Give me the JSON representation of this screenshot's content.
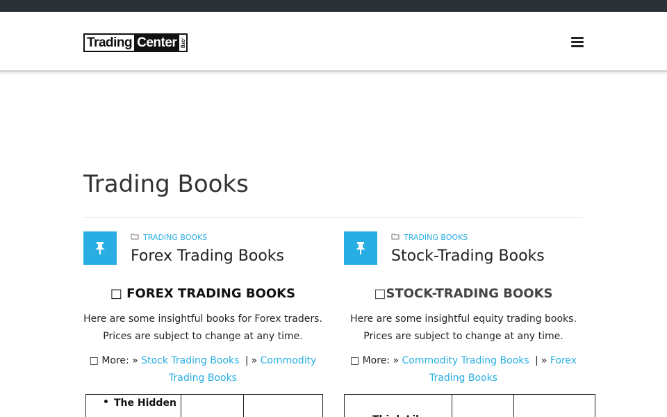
{
  "header": {
    "logo_part1": "Trading",
    "logo_part2": "Center",
    "logo_part3": ".org",
    "menu_icon": "hamburger-icon"
  },
  "page": {
    "title": "Trading Books"
  },
  "posts": [
    {
      "category": "TRADING BOOKS",
      "title": "Forex Trading Books",
      "section_heading": "□ FOREX TRADING BOOKS",
      "description": "Here are some insightful books for Forex traders. Prices are subject to change at any time.",
      "more_prefix": "□ More: »",
      "link1": "Stock Trading Books",
      "separator": "|",
      "link2_prefix": "»",
      "link2": "Commodity Trading Books",
      "table_first_item": "The Hidden"
    },
    {
      "category": "TRADING BOOKS",
      "title": "Stock-Trading Books",
      "section_heading": "□STOCK-TRADING BOOKS",
      "description": "Here are some insightful equity trading books. Prices are subject to change at any time.",
      "more_prefix": "□ More: »",
      "link1": "Commodity Trading Books",
      "separator": "|",
      "link2_prefix": "»",
      "link2": "Forex Trading Books",
      "table_first_item": "Think Like"
    }
  ],
  "colors": {
    "accent": "#29aee3",
    "topbar": "#2b3137"
  }
}
